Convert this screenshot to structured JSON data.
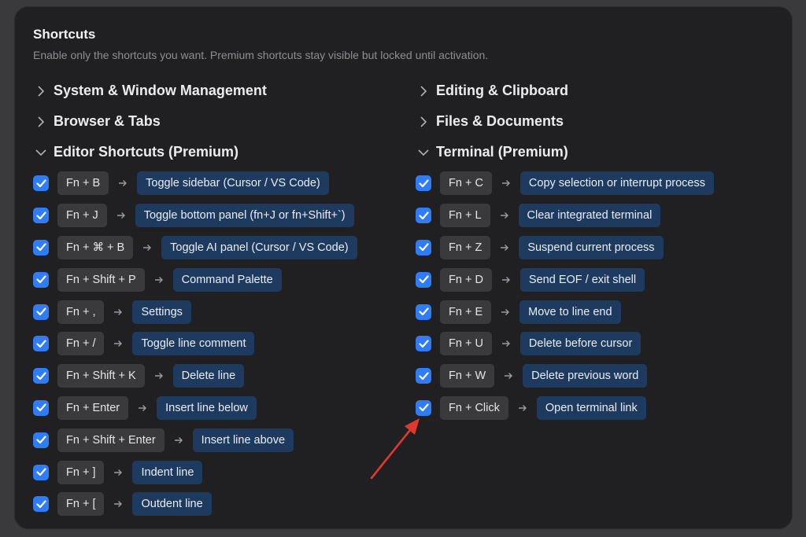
{
  "header": {
    "title": "Shortcuts",
    "subtitle": "Enable only the shortcuts you want. Premium shortcuts stay visible but locked until activation."
  },
  "left_sections": [
    {
      "label": "System & Window Management",
      "expanded": false
    },
    {
      "label": "Browser & Tabs",
      "expanded": false
    },
    {
      "label": "Editor Shortcuts (Premium)",
      "expanded": true
    }
  ],
  "right_sections": [
    {
      "label": "Editing & Clipboard",
      "expanded": false
    },
    {
      "label": "Files & Documents",
      "expanded": false
    },
    {
      "label": "Terminal (Premium)",
      "expanded": true
    }
  ],
  "editor_shortcuts": [
    {
      "key": "Fn + B",
      "action": "Toggle sidebar (Cursor / VS Code)",
      "checked": true
    },
    {
      "key": "Fn + J",
      "action": "Toggle bottom panel (fn+J or fn+Shift+`)",
      "checked": true
    },
    {
      "key": "Fn + ⌘ + B",
      "action": "Toggle AI panel (Cursor / VS Code)",
      "checked": true
    },
    {
      "key": "Fn + Shift + P",
      "action": "Command Palette",
      "checked": true
    },
    {
      "key": "Fn + ,",
      "action": "Settings",
      "checked": true
    },
    {
      "key": "Fn + /",
      "action": "Toggle line comment",
      "checked": true
    },
    {
      "key": "Fn + Shift + K",
      "action": "Delete line",
      "checked": true
    },
    {
      "key": "Fn + Enter",
      "action": "Insert line below",
      "checked": true
    },
    {
      "key": "Fn + Shift + Enter",
      "action": "Insert line above",
      "checked": true
    },
    {
      "key": "Fn + ]",
      "action": "Indent line",
      "checked": true
    },
    {
      "key": "Fn + [",
      "action": "Outdent line",
      "checked": true
    }
  ],
  "terminal_shortcuts": [
    {
      "key": "Fn + C",
      "action": "Copy selection or interrupt process",
      "checked": true
    },
    {
      "key": "Fn + L",
      "action": "Clear integrated terminal",
      "checked": true
    },
    {
      "key": "Fn + Z",
      "action": "Suspend current process",
      "checked": true
    },
    {
      "key": "Fn + D",
      "action": "Send EOF / exit shell",
      "checked": true
    },
    {
      "key": "Fn + E",
      "action": "Move to line end",
      "checked": true
    },
    {
      "key": "Fn + U",
      "action": "Delete before cursor",
      "checked": true
    },
    {
      "key": "Fn + W",
      "action": "Delete previous word",
      "checked": true
    },
    {
      "key": "Fn + Click",
      "action": "Open terminal link",
      "checked": true
    }
  ],
  "colors": {
    "checkbox": "#2f7cf6",
    "key_bg": "#3a3a3c",
    "action_bg": "#1e3a5f",
    "annotation_arrow": "#e0382c"
  },
  "icons": {
    "collapsed": "chevron-right-icon",
    "expanded": "chevron-down-icon",
    "checkbox": "checkmark-icon",
    "mapping": "arrow-right-icon"
  }
}
